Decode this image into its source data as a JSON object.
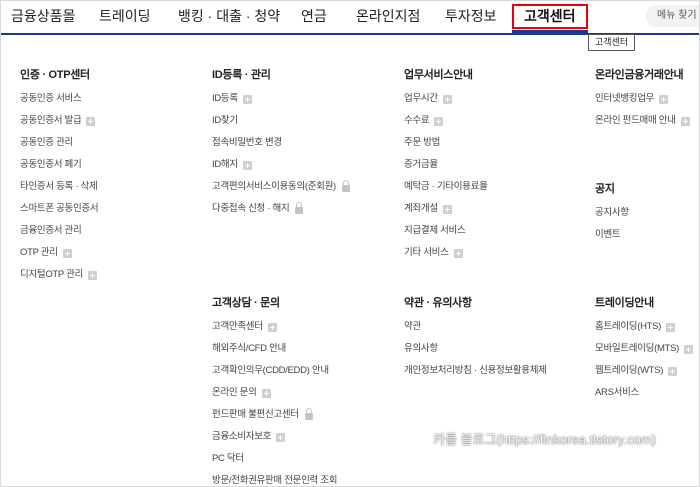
{
  "topnav": {
    "items": [
      {
        "label": "금융상품몰"
      },
      {
        "label": "트레이딩"
      },
      {
        "label": "뱅킹 · 대출 · 청약"
      },
      {
        "label": "연금"
      },
      {
        "label": "온라인지점"
      },
      {
        "label": "투자정보"
      },
      {
        "label": "고객센터"
      }
    ],
    "menu_search_label": "메뉴 찾기",
    "active_color": "#e60012",
    "underline_color": "#1d3a8a"
  },
  "tooltip": "고객센터",
  "sections": {
    "cert": {
      "title": "인증 · OTP센터",
      "items": [
        {
          "label": "공동인증 서비스"
        },
        {
          "label": "공동인증서 발급",
          "icon": "plus-icon"
        },
        {
          "label": "공동인증 관리"
        },
        {
          "label": "공동인증서 폐기"
        },
        {
          "label": "타인증서 등록 · 삭제"
        },
        {
          "label": "스마트폰 공동인증서"
        },
        {
          "label": "금융인증서 관리"
        },
        {
          "label": "OTP 관리",
          "icon": "plus-icon"
        },
        {
          "label": "디지털OTP 관리",
          "icon": "plus-icon"
        }
      ]
    },
    "id": {
      "title": "ID등록 · 관리",
      "items": [
        {
          "label": "ID등록",
          "icon": "plus-icon"
        },
        {
          "label": "ID찾기"
        },
        {
          "label": "접속비밀번호 변경"
        },
        {
          "label": "ID해지",
          "icon": "plus-icon"
        },
        {
          "label": "고객편의서비스이용동의(준회원)",
          "icon": "lock-icon"
        },
        {
          "label": "다중접속 신청 · 해지",
          "icon": "lock-icon"
        }
      ]
    },
    "business": {
      "title": "업무서비스안내",
      "items": [
        {
          "label": "업무시간",
          "icon": "plus-icon"
        },
        {
          "label": "수수료",
          "icon": "plus-icon"
        },
        {
          "label": "주문 방법"
        },
        {
          "label": "증거금율"
        },
        {
          "label": "예탁금 · 기타이용료율"
        },
        {
          "label": "계좌개설",
          "icon": "plus-icon"
        },
        {
          "label": "지급결제 서비스"
        },
        {
          "label": "기타 서비스",
          "icon": "plus-icon"
        }
      ]
    },
    "online_finance": {
      "title": "온라인금융거래안내",
      "items": [
        {
          "label": "인터넷뱅킹업무",
          "icon": "plus-icon"
        },
        {
          "label": "온라인 펀드매매 안내",
          "icon": "plus-icon"
        }
      ]
    },
    "notice": {
      "title": "공지",
      "items": [
        {
          "label": "공지사항"
        },
        {
          "label": "이벤트"
        }
      ]
    },
    "consult": {
      "title": "고객상담 · 문의",
      "items": [
        {
          "label": "고객만족센터",
          "icon": "plus-icon"
        },
        {
          "label": "해외주식/CFD 안내"
        },
        {
          "label": "고객확인의무(CDD/EDD) 안내"
        },
        {
          "label": "온라인 문의",
          "icon": "plus-icon"
        },
        {
          "label": "펀드판매 불편신고센터",
          "icon": "lock-icon"
        },
        {
          "label": "금융소비자보호",
          "icon": "plus-icon"
        },
        {
          "label": "PC 닥터"
        },
        {
          "label": "방문/전화권유판매 전문인력 조회"
        }
      ]
    },
    "terms": {
      "title": "약관 · 유의사항",
      "items": [
        {
          "label": "약관"
        },
        {
          "label": "유의사항"
        },
        {
          "label": "개인정보처리방침 · 신용정보활용체제"
        }
      ]
    },
    "trading_guide": {
      "title": "트레이딩안내",
      "items": [
        {
          "label": "홈트레이딩(HTS)",
          "icon": "plus-icon"
        },
        {
          "label": "모바일트레이딩(MTS)",
          "icon": "plus-icon"
        },
        {
          "label": "웹트레이딩(WTS)",
          "icon": "plus-icon"
        },
        {
          "label": "ARS서비스"
        }
      ]
    }
  },
  "watermark": "카룰 블로그(https://finkorea.tistory.com)"
}
